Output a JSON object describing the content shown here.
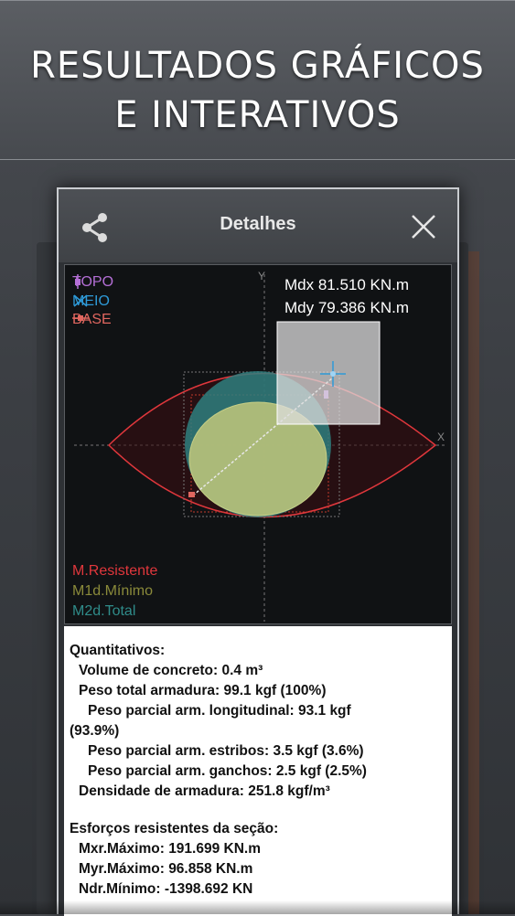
{
  "banner": {
    "line1": "RESULTADOS GRÁFICOS",
    "line2": "E INTERATIVOS"
  },
  "dialog": {
    "title": "Detalhes",
    "share_icon": "share-icon",
    "close_icon": "close-icon"
  },
  "plot": {
    "axis_y_label": "Y",
    "axis_x_label": "X",
    "legend_top": [
      {
        "label": "TOPO",
        "color": "#b46fd6"
      },
      {
        "label": "MEIO",
        "color": "#2e9ad8"
      },
      {
        "label": "BASE",
        "color": "#e0665f"
      }
    ],
    "legend_bottom": [
      {
        "label": "M.Resistente",
        "color": "#e0373c"
      },
      {
        "label": "M1d.Mínimo",
        "color": "#8a8a3a"
      },
      {
        "label": "M2d.Total",
        "color": "#2f8c8a"
      }
    ],
    "mdx": "Mdx 81.510 KN.m",
    "mdy": "Mdy 79.386 KN.m"
  },
  "info": {
    "heading1": "Quantitativos:",
    "volume": "Volume de concreto: 0.4 m³",
    "peso_total": "Peso total armadura: 99.1 kgf  (100%)",
    "peso_long_a": "Peso parcial arm. longitudinal: 93.1 kgf",
    "peso_long_b": "(93.9%)",
    "peso_estribos": "Peso parcial arm. estribos: 3.5 kgf  (3.6%)",
    "peso_ganchos": "Peso parcial arm. ganchos: 2.5 kgf  (2.5%)",
    "densidade": "Densidade de armadura: 251.8 kgf/m³",
    "heading2": "Esforços resistentes da seção:",
    "mxr": "Mxr.Máximo: 191.699 KN.m",
    "myr": "Myr.Máximo: 96.858 KN.m",
    "ndr": "Ndr.Mínimo: -1398.692 KN"
  }
}
